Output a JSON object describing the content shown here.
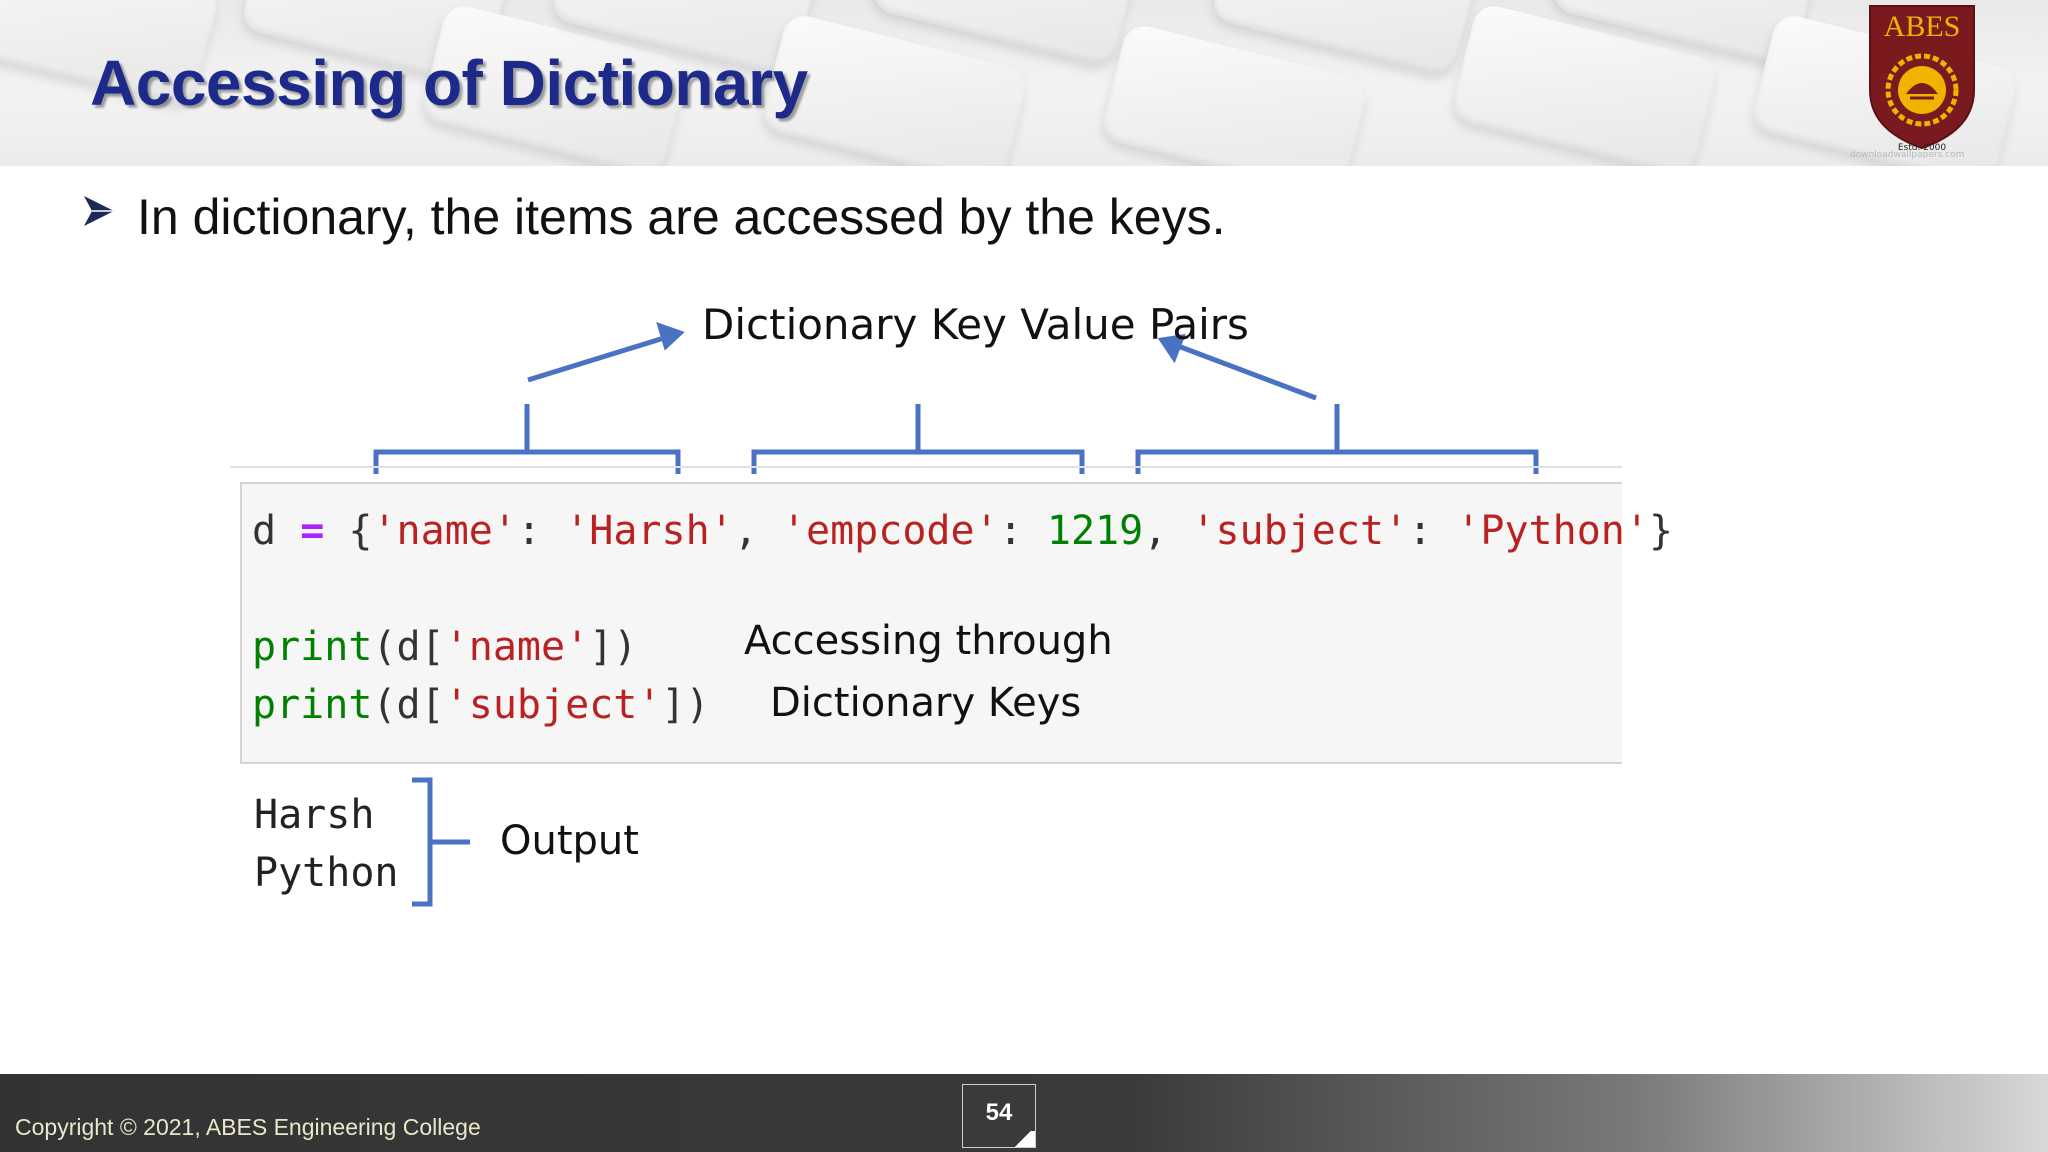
{
  "header": {
    "title": "Accessing of Dictionary",
    "logo": {
      "name": "ABES",
      "established": "Estd. 2000",
      "colors": {
        "shield": "#7a1a1f",
        "emblem": "#f0b400",
        "text": "#f0b400"
      }
    },
    "watermark": "downloadwallpapers.com"
  },
  "bullet": {
    "icon": "arrow-bullet-icon",
    "text": "In dictionary, the items are accessed by the keys."
  },
  "diagram": {
    "pairs_label": "Dictionary Key Value Pairs",
    "code_line_1": {
      "var": "d",
      "op": "=",
      "open": "{",
      "k1": "'name'",
      "colon1": ":",
      "v1": "'Harsh'",
      "comma1": ",",
      "k2": "'empcode'",
      "colon2": ":",
      "v2": "1219",
      "comma2": ",",
      "k3": "'subject'",
      "colon3": ":",
      "v3": "'Python'",
      "close": "}"
    },
    "print_1": {
      "fn": "print",
      "pre": "(d[",
      "key": "'name'",
      "post": "])"
    },
    "print_2": {
      "fn": "print",
      "pre": "(d[",
      "key": "'subject'",
      "post": "])"
    },
    "access_label_1": "Accessing through",
    "access_label_2": "Dictionary Keys",
    "output_lines": [
      "Harsh",
      "Python"
    ],
    "output_label": "Output",
    "colors": {
      "bracket": "#4a72c4",
      "string": "#ba2121",
      "number": "#008000",
      "function": "#008000",
      "operator": "#aa22ff"
    }
  },
  "footer": {
    "copyright": "Copyright © 2021, ABES Engineering College",
    "page_number": "54"
  }
}
